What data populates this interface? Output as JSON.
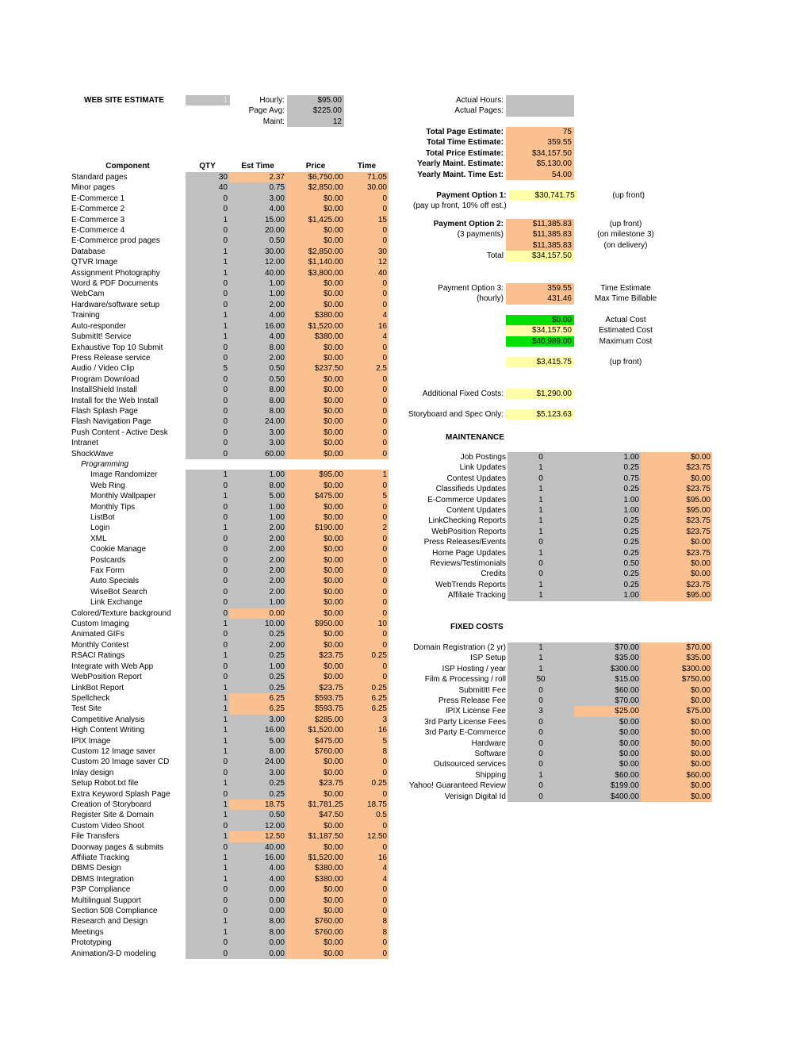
{
  "header": {
    "title": "WEB SITE ESTIMATE",
    "version_box": "1",
    "rates": [
      {
        "label": "Hourly:",
        "value": "$95.00"
      },
      {
        "label": "Page Avg:",
        "value": "$225.00"
      },
      {
        "label": "Maint:",
        "value": "12"
      }
    ],
    "actual": [
      {
        "label": "Actual Hours:",
        "value": ""
      },
      {
        "label": "Actual Pages:",
        "value": ""
      }
    ]
  },
  "totals": [
    {
      "label": "Total Page Estimate:",
      "value": "75"
    },
    {
      "label": "Total Time Estimate:",
      "value": "359.55"
    },
    {
      "label": "Total Price Estimate:",
      "value": "$34,157.50"
    },
    {
      "label": "Yearly Maint. Estimate:",
      "value": "$5,130.00"
    },
    {
      "label": "Yearly Maint. Time Est:",
      "value": "54.00"
    }
  ],
  "payment_option_1": {
    "label": "Payment Option 1:",
    "value": "$30,741.75",
    "note": "(up front)",
    "sublabel": "(pay up front, 10% off est.)"
  },
  "payment_option_2": {
    "label": "Payment Option 2:",
    "sublabel": "(3 payments)",
    "total_label": "Total",
    "rows": [
      {
        "value": "$11,385.83",
        "note": "(up front)"
      },
      {
        "value": "$11,385.83",
        "note": "(on milestone 3)"
      },
      {
        "value": "$11,385.83",
        "note": "(on delivery)"
      }
    ],
    "total_value": "$34,157.50"
  },
  "payment_option_3": {
    "label": "Payment Option 3:",
    "sublabel": "(hourly)",
    "rows": [
      {
        "value": "359.55",
        "note": "Time Estimate"
      },
      {
        "value": "431.46",
        "note": "Max Time Billable"
      }
    ]
  },
  "cost_summary": [
    {
      "value": "$0.00",
      "note": "Actual Cost",
      "fill": "green"
    },
    {
      "value": "$34,157.50",
      "note": "Estimated Cost",
      "fill": "yellow"
    },
    {
      "value": "$40,989.00",
      "note": "Maximum Cost",
      "fill": "green"
    }
  ],
  "upfront_row": {
    "value": "$3,415.75",
    "note": "(up front)"
  },
  "additional_fixed_costs": {
    "label": "Additional Fixed Costs:",
    "value": "$1,290.00"
  },
  "storyboard_spec_only": {
    "label": "Storyboard and Spec Only:",
    "value": "$5,123.63"
  },
  "main_table": {
    "columns": [
      "Component",
      "QTY",
      "Est Time",
      "Price",
      "Time"
    ],
    "rows": [
      {
        "name": "Standard pages",
        "qty": "30",
        "est": "2.37",
        "price": "$6,750.00",
        "time": "71.05",
        "est_fill": "orange"
      },
      {
        "name": "Minor pages",
        "qty": "40",
        "est": "0.75",
        "price": "$2,850.00",
        "time": "30.00"
      },
      {
        "name": "E-Commerce 1",
        "qty": "0",
        "est": "3.00",
        "price": "$0.00",
        "time": "0"
      },
      {
        "name": "E-Commerce 2",
        "qty": "0",
        "est": "4.00",
        "price": "$0.00",
        "time": "0"
      },
      {
        "name": "E-Commerce 3",
        "qty": "1",
        "est": "15.00",
        "price": "$1,425.00",
        "time": "15"
      },
      {
        "name": "E-Commerce 4",
        "qty": "0",
        "est": "20.00",
        "price": "$0.00",
        "time": "0"
      },
      {
        "name": "E-Commerce prod pages",
        "qty": "0",
        "est": "0.50",
        "price": "$0.00",
        "time": "0"
      },
      {
        "name": "Database",
        "qty": "1",
        "est": "30.00",
        "price": "$2,850.00",
        "time": "30"
      },
      {
        "name": "QTVR Image",
        "qty": "1",
        "est": "12.00",
        "price": "$1,140.00",
        "time": "12"
      },
      {
        "name": "Assignment Photography",
        "qty": "1",
        "est": "40.00",
        "price": "$3,800.00",
        "time": "40"
      },
      {
        "name": "Word & PDF Documents",
        "qty": "0",
        "est": "1.00",
        "price": "$0.00",
        "time": "0"
      },
      {
        "name": "WebCam",
        "qty": "0",
        "est": "1.00",
        "price": "$0.00",
        "time": "0"
      },
      {
        "name": "Hardware/software setup",
        "qty": "0",
        "est": "2.00",
        "price": "$0.00",
        "time": "0"
      },
      {
        "name": "Training",
        "qty": "1",
        "est": "4.00",
        "price": "$380.00",
        "time": "4"
      },
      {
        "name": "Auto-responder",
        "qty": "1",
        "est": "16.00",
        "price": "$1,520.00",
        "time": "16"
      },
      {
        "name": "SubmitIt! Service",
        "qty": "1",
        "est": "4.00",
        "price": "$380.00",
        "time": "4"
      },
      {
        "name": "Exhaustive Top 10 Submit",
        "qty": "0",
        "est": "8.00",
        "price": "$0.00",
        "time": "0"
      },
      {
        "name": "Press Release service",
        "qty": "0",
        "est": "2.00",
        "price": "$0.00",
        "time": "0"
      },
      {
        "name": "Audio / Video Clip",
        "qty": "5",
        "est": "0.50",
        "price": "$237.50",
        "time": "2.5"
      },
      {
        "name": "Program Download",
        "qty": "0",
        "est": "0.50",
        "price": "$0.00",
        "time": "0"
      },
      {
        "name": "InstallShield Install",
        "qty": "0",
        "est": "8.00",
        "price": "$0.00",
        "time": "0"
      },
      {
        "name": "Install for the Web Install",
        "qty": "0",
        "est": "8.00",
        "price": "$0.00",
        "time": "0"
      },
      {
        "name": "Flash Splash Page",
        "qty": "0",
        "est": "8.00",
        "price": "$0.00",
        "time": "0"
      },
      {
        "name": "Flash Navigation Page",
        "qty": "0",
        "est": "24.00",
        "price": "$0.00",
        "time": "0"
      },
      {
        "name": "Push Content - Active Desk",
        "qty": "0",
        "est": "3.00",
        "price": "$0.00",
        "time": "0"
      },
      {
        "name": "Intranet",
        "qty": "0",
        "est": "3.00",
        "price": "$0.00",
        "time": "0"
      },
      {
        "name": "ShockWave",
        "qty": "0",
        "est": "60.00",
        "price": "$0.00",
        "time": "0"
      },
      {
        "name": "Programming",
        "qty": "",
        "est": "",
        "price": "",
        "time": "",
        "style": "section"
      },
      {
        "name": "Image Randomizer",
        "qty": "1",
        "est": "1.00",
        "price": "$95.00",
        "time": "1",
        "indent": 2
      },
      {
        "name": "Web Ring",
        "qty": "0",
        "est": "8.00",
        "price": "$0.00",
        "time": "0",
        "indent": 2
      },
      {
        "name": "Monthly Wallpaper",
        "qty": "1",
        "est": "5.00",
        "price": "$475.00",
        "time": "5",
        "indent": 2
      },
      {
        "name": "Monthly Tips",
        "qty": "0",
        "est": "1.00",
        "price": "$0.00",
        "time": "0",
        "indent": 2
      },
      {
        "name": "ListBot",
        "qty": "0",
        "est": "1.00",
        "price": "$0.00",
        "time": "0",
        "indent": 2
      },
      {
        "name": "Login",
        "qty": "1",
        "est": "2.00",
        "price": "$190.00",
        "time": "2",
        "indent": 2
      },
      {
        "name": "XML",
        "qty": "0",
        "est": "2.00",
        "price": "$0.00",
        "time": "0",
        "indent": 2
      },
      {
        "name": "Cookie Manage",
        "qty": "0",
        "est": "2.00",
        "price": "$0.00",
        "time": "0",
        "indent": 2
      },
      {
        "name": "Postcards",
        "qty": "0",
        "est": "2.00",
        "price": "$0.00",
        "time": "0",
        "indent": 2
      },
      {
        "name": "Fax Form",
        "qty": "0",
        "est": "2.00",
        "price": "$0.00",
        "time": "0",
        "indent": 2
      },
      {
        "name": "Auto Specials",
        "qty": "0",
        "est": "2.00",
        "price": "$0.00",
        "time": "0",
        "indent": 2
      },
      {
        "name": "WiseBot Search",
        "qty": "0",
        "est": "2.00",
        "price": "$0.00",
        "time": "0",
        "indent": 2
      },
      {
        "name": "Link Exchange",
        "qty": "0",
        "est": "1.00",
        "price": "$0.00",
        "time": "0",
        "indent": 2
      },
      {
        "name": "Colored/Texture background",
        "qty": "0",
        "est": "0.00",
        "price": "$0.00",
        "time": "0",
        "est_fill": "orange"
      },
      {
        "name": "Custom Imaging",
        "qty": "1",
        "est": "10.00",
        "price": "$950.00",
        "time": "10"
      },
      {
        "name": "Animated GIFs",
        "qty": "0",
        "est": "0.25",
        "price": "$0.00",
        "time": "0"
      },
      {
        "name": "Monthly Contest",
        "qty": "0",
        "est": "2.00",
        "price": "$0.00",
        "time": "0"
      },
      {
        "name": "RSACI Ratings",
        "qty": "1",
        "est": "0.25",
        "price": "$23.75",
        "time": "0.25"
      },
      {
        "name": "Integrate with Web App",
        "qty": "0",
        "est": "1.00",
        "price": "$0.00",
        "time": "0"
      },
      {
        "name": "WebPosition Report",
        "qty": "0",
        "est": "0.25",
        "price": "$0.00",
        "time": "0"
      },
      {
        "name": "LinkBot Report",
        "qty": "1",
        "est": "0.25",
        "price": "$23.75",
        "time": "0.25"
      },
      {
        "name": "Spellcheck",
        "qty": "1",
        "est": "6.25",
        "price": "$593.75",
        "time": "6.25",
        "est_fill": "orange"
      },
      {
        "name": "Test Site",
        "qty": "1",
        "est": "6.25",
        "price": "$593.75",
        "time": "6.25",
        "est_fill": "orange"
      },
      {
        "name": "Competitive Analysis",
        "qty": "1",
        "est": "3.00",
        "price": "$285.00",
        "time": "3"
      },
      {
        "name": "High Content Writing",
        "qty": "1",
        "est": "16.00",
        "price": "$1,520.00",
        "time": "16"
      },
      {
        "name": "IPIX Image",
        "qty": "1",
        "est": "5.00",
        "price": "$475.00",
        "time": "5"
      },
      {
        "name": "Custom 12 Image saver",
        "qty": "1",
        "est": "8.00",
        "price": "$760.00",
        "time": "8"
      },
      {
        "name": "Custom 20 Image saver CD",
        "qty": "0",
        "est": "24.00",
        "price": "$0.00",
        "time": "0"
      },
      {
        "name": "Inlay design",
        "qty": "0",
        "est": "3.00",
        "price": "$0.00",
        "time": "0"
      },
      {
        "name": "Setup Robot.txt file",
        "qty": "1",
        "est": "0.25",
        "price": "$23.75",
        "time": "0.25"
      },
      {
        "name": "Extra Keyword Splash Page",
        "qty": "0",
        "est": "0.25",
        "price": "$0.00",
        "time": "0"
      },
      {
        "name": "Creation of Storyboard",
        "qty": "1",
        "est": "18.75",
        "price": "$1,781.25",
        "time": "18.75",
        "est_fill": "orange"
      },
      {
        "name": "Register Site & Domain",
        "qty": "1",
        "est": "0.50",
        "price": "$47.50",
        "time": "0.5"
      },
      {
        "name": "Custom Video Shoot",
        "qty": "0",
        "est": "12.00",
        "price": "$0.00",
        "time": "0"
      },
      {
        "name": "File Transfers",
        "qty": "1",
        "est": "12.50",
        "price": "$1,187.50",
        "time": "12.50",
        "est_fill": "orange"
      },
      {
        "name": "Doorway pages & submits",
        "qty": "0",
        "est": "40.00",
        "price": "$0.00",
        "time": "0"
      },
      {
        "name": "Affiliate Tracking",
        "qty": "1",
        "est": "16.00",
        "price": "$1,520.00",
        "time": "16"
      },
      {
        "name": "DBMS Design",
        "qty": "1",
        "est": "4.00",
        "price": "$380.00",
        "time": "4"
      },
      {
        "name": "DBMS Integration",
        "qty": "1",
        "est": "4.00",
        "price": "$380.00",
        "time": "4"
      },
      {
        "name": "P3P Compliance",
        "qty": "0",
        "est": "0.00",
        "price": "$0.00",
        "time": "0"
      },
      {
        "name": "Multilingual Support",
        "qty": "0",
        "est": "0.00",
        "price": "$0.00",
        "time": "0"
      },
      {
        "name": "Section 508 Compliance",
        "qty": "0",
        "est": "0.00",
        "price": "$0.00",
        "time": "0"
      },
      {
        "name": "Research and Design",
        "qty": "1",
        "est": "8.00",
        "price": "$760.00",
        "time": "8"
      },
      {
        "name": "Meetings",
        "qty": "1",
        "est": "8.00",
        "price": "$760.00",
        "time": "8"
      },
      {
        "name": "Prototyping",
        "qty": "0",
        "est": "0.00",
        "price": "$0.00",
        "time": "0"
      },
      {
        "name": "Animation/3-D modeling",
        "qty": "0",
        "est": "0.00",
        "price": "$0.00",
        "time": "0"
      }
    ]
  },
  "maintenance": {
    "title": "MAINTENANCE",
    "rows": [
      {
        "name": "Job Postings",
        "qty": "0",
        "hours": "1.00",
        "cost": "$0.00"
      },
      {
        "name": "Link Updates",
        "qty": "1",
        "hours": "0.25",
        "cost": "$23.75"
      },
      {
        "name": "Contest Updates",
        "qty": "0",
        "hours": "0.75",
        "cost": "$0.00"
      },
      {
        "name": "Classifieds Updates",
        "qty": "1",
        "hours": "0.25",
        "cost": "$23.75"
      },
      {
        "name": "E-Commerce Updates",
        "qty": "1",
        "hours": "1.00",
        "cost": "$95.00"
      },
      {
        "name": "Content Updates",
        "qty": "1",
        "hours": "1.00",
        "cost": "$95.00"
      },
      {
        "name": "LinkChecking Reports",
        "qty": "1",
        "hours": "0.25",
        "cost": "$23.75"
      },
      {
        "name": "WebPosition Reports",
        "qty": "1",
        "hours": "0.25",
        "cost": "$23.75"
      },
      {
        "name": "Press Releases/Events",
        "qty": "0",
        "hours": "0.25",
        "cost": "$0.00"
      },
      {
        "name": "Home Page Updates",
        "qty": "1",
        "hours": "0.25",
        "cost": "$23.75"
      },
      {
        "name": "Reviews/Testimonials",
        "qty": "0",
        "hours": "0.50",
        "cost": "$0.00"
      },
      {
        "name": "Credits",
        "qty": "0",
        "hours": "0.25",
        "cost": "$0.00"
      },
      {
        "name": "WebTrends Reports",
        "qty": "1",
        "hours": "0.25",
        "cost": "$23.75"
      },
      {
        "name": "Affiliate Tracking",
        "qty": "1",
        "hours": "1.00",
        "cost": "$95.00"
      }
    ]
  },
  "fixed_costs": {
    "title": "FIXED COSTS",
    "rows": [
      {
        "name": "Domain Registration (2 yr)",
        "qty": "1",
        "unit": "$70.00",
        "total": "$70.00"
      },
      {
        "name": "ISP Setup",
        "qty": "1",
        "unit": "$35.00",
        "total": "$35.00"
      },
      {
        "name": "ISP Hosting / year",
        "qty": "1",
        "unit": "$300.00",
        "total": "$300.00"
      },
      {
        "name": "Film & Processing / roll",
        "qty": "50",
        "unit": "$15.00",
        "total": "$750.00"
      },
      {
        "name": "SubmitIt! Fee",
        "qty": "0",
        "unit": "$60.00",
        "total": "$0.00"
      },
      {
        "name": "Press Release Fee",
        "qty": "0",
        "unit": "$70.00",
        "total": "$0.00"
      },
      {
        "name": "IPIX License Fee",
        "qty": "3",
        "unit": "$25.00",
        "total": "$75.00",
        "unit_fill": "orange"
      },
      {
        "name": "3rd Party License Fees",
        "qty": "0",
        "unit": "$0.00",
        "total": "$0.00"
      },
      {
        "name": "3rd Party E-Commerce",
        "qty": "0",
        "unit": "$0.00",
        "total": "$0.00"
      },
      {
        "name": "Hardware",
        "qty": "0",
        "unit": "$0.00",
        "total": "$0.00"
      },
      {
        "name": "Software",
        "qty": "0",
        "unit": "$0.00",
        "total": "$0.00"
      },
      {
        "name": "Outsourced services",
        "qty": "0",
        "unit": "$0.00",
        "total": "$0.00"
      },
      {
        "name": "Shipping",
        "qty": "1",
        "unit": "$60.00",
        "total": "$60.00"
      },
      {
        "name": "Yahoo! Guaranteed Review",
        "qty": "0",
        "unit": "$199.00",
        "total": "$0.00"
      },
      {
        "name": "Verisign Digital Id",
        "qty": "0",
        "unit": "$400.00",
        "total": "$0.00"
      }
    ]
  },
  "colors": {
    "gray": "#c0c0c0",
    "orange": "#fac090",
    "yellow": "#ffffa8",
    "green": "#00e000"
  }
}
